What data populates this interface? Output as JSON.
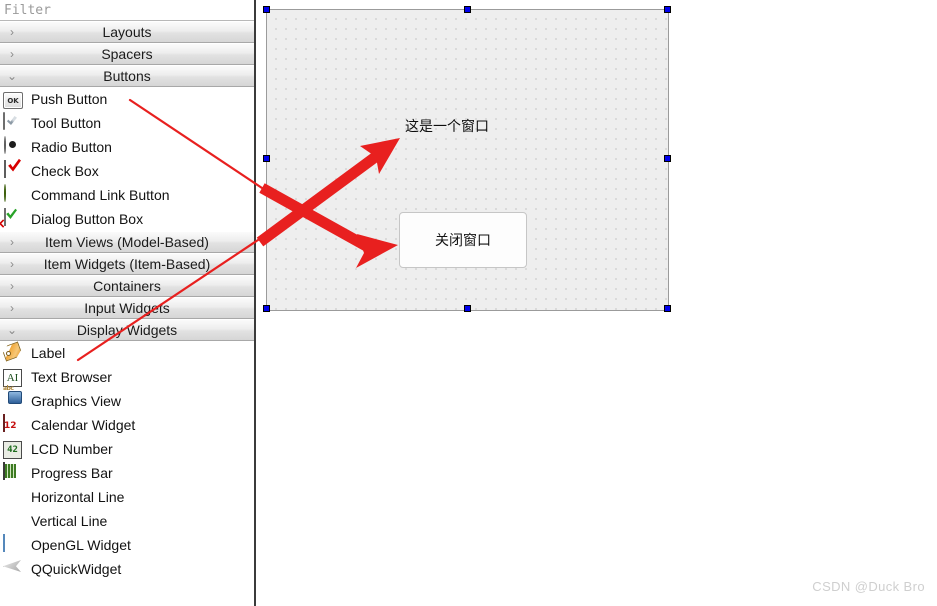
{
  "widget_box": {
    "filter": {
      "placeholder": "Filter",
      "value": ""
    },
    "categories": [
      {
        "label": "Layouts",
        "expanded": false,
        "chevron": "chevron-right-icon"
      },
      {
        "label": "Spacers",
        "expanded": false,
        "chevron": "chevron-right-icon"
      },
      {
        "label": "Buttons",
        "expanded": true,
        "chevron": "chevron-down-icon"
      },
      {
        "label": "Item Views (Model-Based)",
        "expanded": false,
        "chevron": "chevron-right-icon"
      },
      {
        "label": "Item Widgets (Item-Based)",
        "expanded": false,
        "chevron": "chevron-right-icon"
      },
      {
        "label": "Containers",
        "expanded": false,
        "chevron": "chevron-right-icon"
      },
      {
        "label": "Input Widgets",
        "expanded": false,
        "chevron": "chevron-right-icon"
      },
      {
        "label": "Display Widgets",
        "expanded": true,
        "chevron": "chevron-down-icon"
      }
    ],
    "buttons_items": [
      {
        "label": "Push Button",
        "icon": "push-button-icon",
        "icon_text": "OK"
      },
      {
        "label": "Tool Button",
        "icon": "tool-button-icon",
        "icon_text": ""
      },
      {
        "label": "Radio Button",
        "icon": "radio-button-icon",
        "icon_text": ""
      },
      {
        "label": "Check Box",
        "icon": "check-box-icon",
        "icon_text": ""
      },
      {
        "label": "Command Link Button",
        "icon": "command-link-button-icon",
        "icon_text": ""
      },
      {
        "label": "Dialog Button Box",
        "icon": "dialog-button-box-icon",
        "icon_text": ""
      }
    ],
    "display_items": [
      {
        "label": "Label",
        "icon": "label-icon",
        "icon_text": ""
      },
      {
        "label": "Text Browser",
        "icon": "text-browser-icon",
        "icon_text": "AI"
      },
      {
        "label": "Graphics View",
        "icon": "graphics-view-icon",
        "icon_text": ""
      },
      {
        "label": "Calendar Widget",
        "icon": "calendar-widget-icon",
        "icon_text": "12"
      },
      {
        "label": "LCD Number",
        "icon": "lcd-number-icon",
        "icon_text": "42"
      },
      {
        "label": "Progress Bar",
        "icon": "progress-bar-icon",
        "icon_text": ""
      },
      {
        "label": "Horizontal Line",
        "icon": "horizontal-line-icon",
        "icon_text": ""
      },
      {
        "label": "Vertical Line",
        "icon": "vertical-line-icon",
        "icon_text": ""
      },
      {
        "label": "OpenGL Widget",
        "icon": "opengl-widget-icon",
        "icon_text": ""
      },
      {
        "label": "QQuickWidget",
        "icon": "qquickwidget-icon",
        "icon_text": ""
      }
    ]
  },
  "form": {
    "label_text": "这是一个窗口",
    "button_text": "关闭窗口",
    "selection_handles": 8,
    "grid_spacing_px": 10
  },
  "annotations": {
    "arrow_color": "#e8201f",
    "arrows": [
      {
        "name": "push-button-to-close-button-arrow",
        "from": "Push Button",
        "to": "关闭窗口"
      },
      {
        "name": "label-to-window-label-arrow",
        "from": "Label",
        "to": "这是一个窗口"
      }
    ]
  },
  "watermark": {
    "text": "CSDN @Duck Bro"
  }
}
